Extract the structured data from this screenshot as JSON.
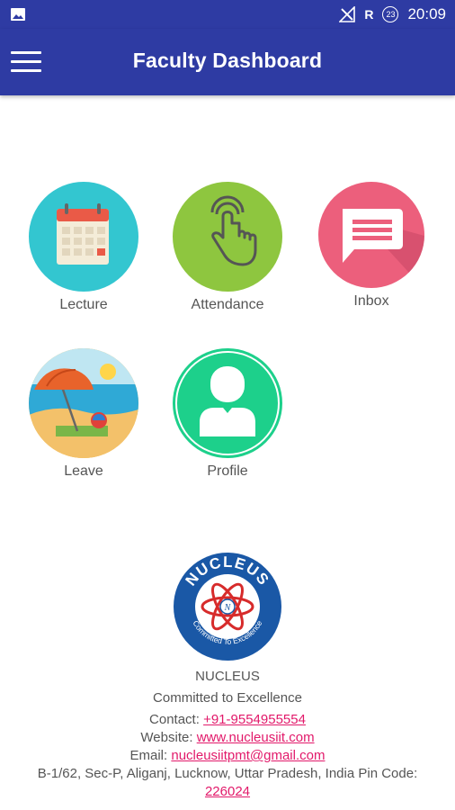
{
  "status_bar": {
    "time": "20:09",
    "network": "R",
    "badge": "23"
  },
  "app_bar": {
    "title": "Faculty Dashboard"
  },
  "tiles": [
    {
      "label": "Lecture",
      "color": "#33c6d0",
      "icon": "calendar-icon"
    },
    {
      "label": "Attendance",
      "color": "#8ec63f",
      "icon": "tap-hand-icon"
    },
    {
      "label": "Inbox",
      "color": "#ec5f7c",
      "icon": "message-icon"
    },
    {
      "label": "Leave",
      "color": "#f2b93b",
      "icon": "beach-icon"
    },
    {
      "label": "Profile",
      "color": "#1dd08b",
      "icon": "user-icon"
    }
  ],
  "footer": {
    "logo_text_top": "NUCLEUS",
    "logo_text_bottom": "Committed To Excellence",
    "name": "NUCLEUS",
    "tagline": "Committed to Excellence",
    "contact_label": "Contact:",
    "contact_value": "+91-9554955554",
    "website_label": "Website:",
    "website_value": "www.nucleusiit.com",
    "email_label": "Email:",
    "email_value": "nucleusiitpmt@gmail.com",
    "address": "B-1/62, Sec-P, Aliganj, Lucknow, Uttar Pradesh, India Pin Code:",
    "pincode": "226024"
  },
  "colors": {
    "primary": "#2e3ba3",
    "link": "#e2196a"
  }
}
